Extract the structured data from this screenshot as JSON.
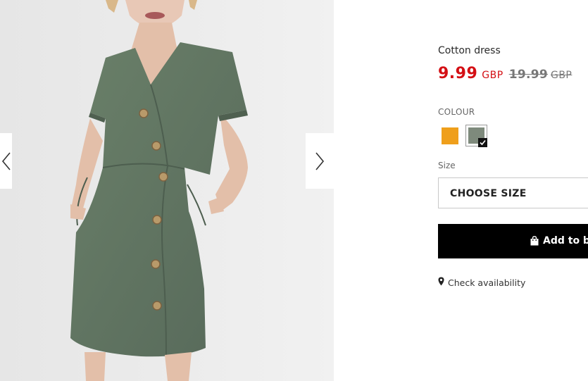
{
  "product": {
    "title": "Cotton dress",
    "price_current": "9.99",
    "currency_current": "GBP",
    "price_original": "19.99",
    "currency_original": "GBP",
    "colors": {
      "sale": "#d40f14",
      "swatches": [
        "#ef9f1b",
        "#7e8a7c"
      ]
    }
  },
  "colour": {
    "label": "COLOUR",
    "selected_index": 1
  },
  "size": {
    "label": "Size",
    "select_value": "CHOOSE SIZE"
  },
  "cart": {
    "add_label": "Add to ba",
    "icon": "shopping-bag-icon"
  },
  "store": {
    "availability_label": "Check availability",
    "icon": "map-pin-icon"
  },
  "gallery": {
    "prev_icon": "chevron-left-icon",
    "next_icon": "chevron-right-icon"
  }
}
